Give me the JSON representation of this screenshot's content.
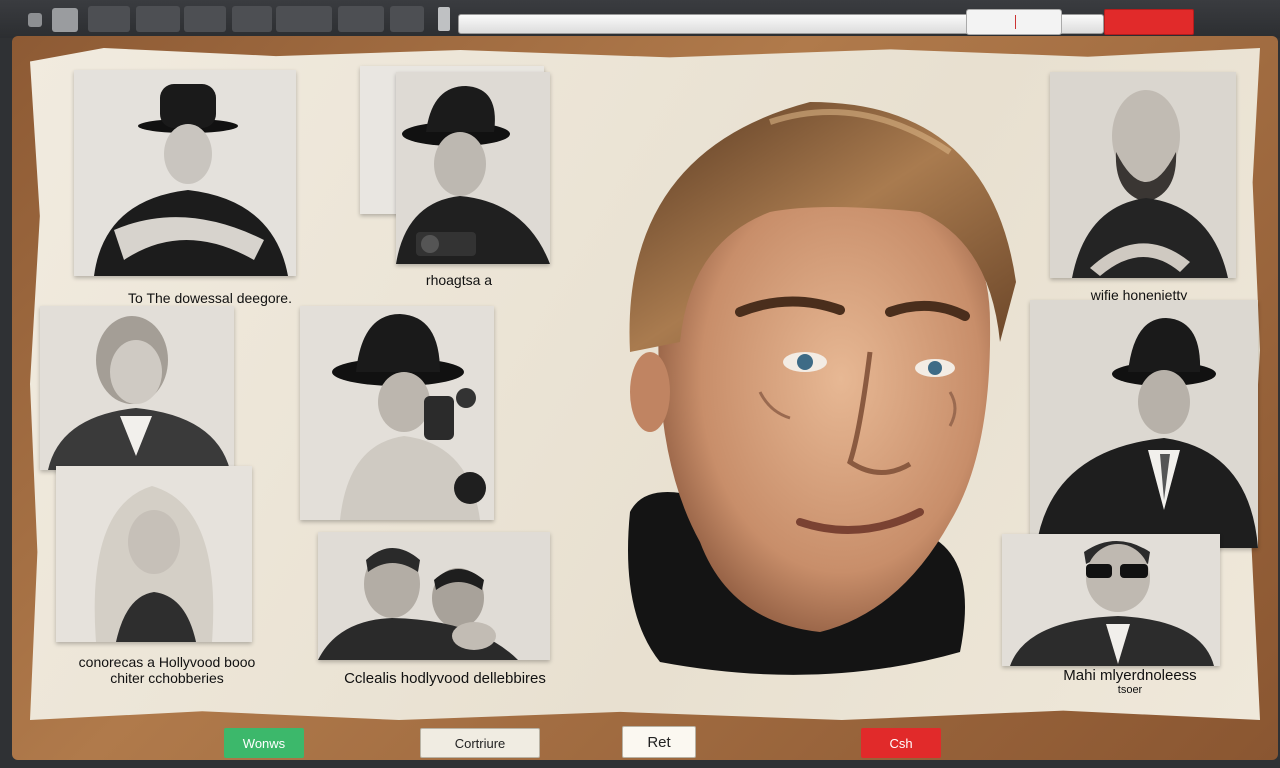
{
  "captions": {
    "c1": "To The dowessal deegore.",
    "c2": "rhoagtsa a",
    "c3": "wifie honenietty",
    "c4_line1": "conorecas a Hollyvood booo",
    "c4_line2": "chiter cchobberies",
    "c5": "Cclealis hodlyvood dellebbires",
    "c6_line1": "Mahi mlyerdnoleess",
    "c6_line2": "tsoer"
  },
  "buttons": {
    "green": "Wonws",
    "continue": "Cortriure",
    "ret": "Ret",
    "cash": "Csh"
  },
  "colors": {
    "accent_red": "#e12a2a",
    "accent_green": "#3cb86b",
    "board": "#a06c40",
    "paper": "#eee7da"
  }
}
